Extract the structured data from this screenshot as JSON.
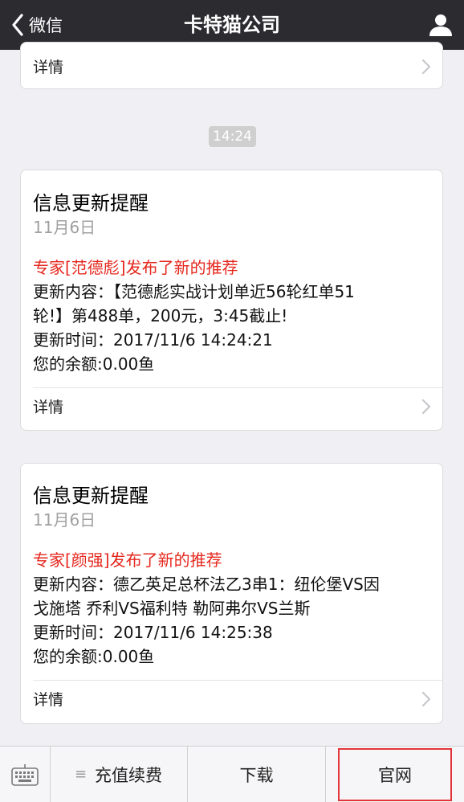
{
  "nav": {
    "back_label": "微信",
    "title": "卡特猫公司"
  },
  "top_card": {
    "detail_label": "详情"
  },
  "timestamp": "14:24",
  "messages": [
    {
      "title": "信息更新提醒",
      "date": "11月6日",
      "highlight": "专家[范德彪]发布了新的推荐",
      "lines": [
        "更新内容：【范德彪实战计划单近56轮红单51",
        "轮!】第488单，200元，3:45截止!",
        "更新时间：2017/11/6 14:24:21",
        "您的余额:0.00鱼"
      ],
      "detail_label": "详情"
    },
    {
      "title": "信息更新提醒",
      "date": "11月6日",
      "highlight": "专家[颜强]发布了新的推荐",
      "lines": [
        "更新内容：德乙英足总杯法乙3串1：纽伦堡VS因",
        "戈施塔 乔利VS福利特 勒阿弗尔VS兰斯",
        "更新时间：2017/11/6 14:25:38",
        "您的余额:0.00鱼"
      ],
      "detail_label": "详情"
    }
  ],
  "bottom_menu": {
    "items": [
      "充值续费",
      "下载",
      "官网"
    ],
    "menu_icon": "≡"
  },
  "colors": {
    "nav_bg": "#2b2b30",
    "highlight": "#e5281e",
    "selected_outline": "#e2353b",
    "page_bg": "#efeff4"
  }
}
